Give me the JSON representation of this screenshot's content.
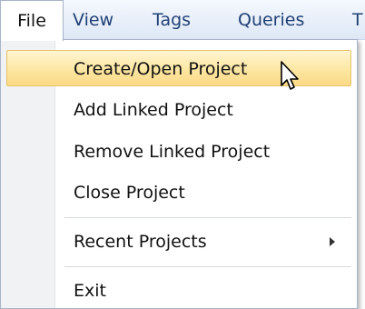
{
  "menubar": {
    "items": [
      {
        "label": "File"
      },
      {
        "label": "View"
      },
      {
        "label": "Tags"
      },
      {
        "label": "Queries"
      },
      {
        "label": "T"
      }
    ]
  },
  "file_menu": {
    "items": [
      {
        "label": "Create/Open Project",
        "state": "hovered"
      },
      {
        "label": "Add Linked Project"
      },
      {
        "label": "Remove Linked Project"
      },
      {
        "label": "Close Project"
      },
      {
        "label": "Recent Projects",
        "has_submenu": true
      },
      {
        "label": "Exit"
      }
    ]
  },
  "colors": {
    "menubar_text": "#1f3f74",
    "hover_top": "#fff5d2",
    "hover_bottom": "#fcd985",
    "hover_border": "#e5c36a"
  },
  "icons": {
    "cursor": "mouse-pointer-icon",
    "submenu": "chevron-right-icon"
  }
}
